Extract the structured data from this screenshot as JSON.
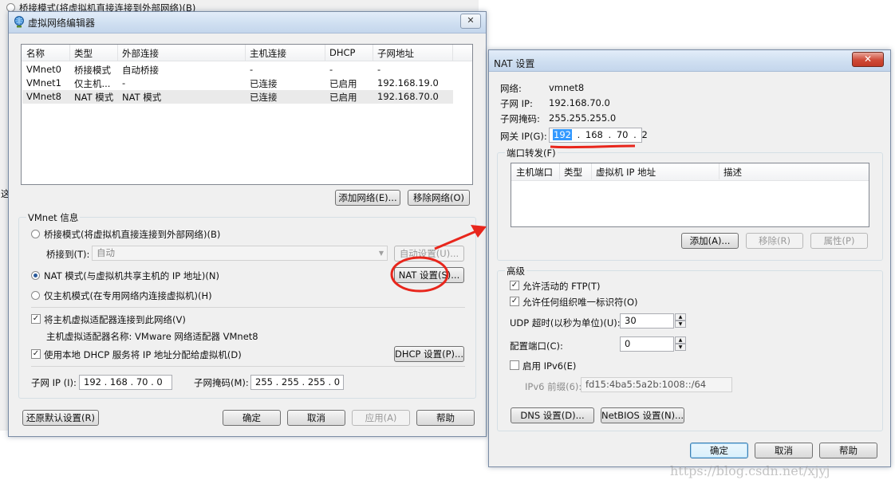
{
  "background_window": {
    "radio_label": "桥接模式(将虚拟机直接连接到外部网络)(B)",
    "left_fragment": "这"
  },
  "vne": {
    "title": "虚拟网络编辑器",
    "close_label": "✕",
    "table": {
      "headers": [
        "名称",
        "类型",
        "外部连接",
        "主机连接",
        "DHCP",
        "子网地址"
      ],
      "rows": [
        [
          "VMnet0",
          "桥接模式",
          "自动桥接",
          "-",
          "-",
          "-"
        ],
        [
          "VMnet1",
          "仅主机...",
          "-",
          "已连接",
          "已启用",
          "192.168.19.0"
        ],
        [
          "VMnet8",
          "NAT 模式",
          "NAT 模式",
          "已连接",
          "已启用",
          "192.168.70.0"
        ]
      ]
    },
    "add_network": "添加网络(E)...",
    "remove_network": "移除网络(O)",
    "vmnet_info": "VMnet 信息",
    "bridge_mode": "桥接模式(将虚拟机直接连接到外部网络)(B)",
    "bridge_to_label": "桥接到(T):",
    "bridge_to_value": "自动",
    "auto_settings": "自动设置(U)...",
    "nat_mode": "NAT 模式(与虚拟机共享主机的 IP 地址)(N)",
    "nat_settings": "NAT 设置(S)...",
    "host_only": "仅主机模式(在专用网络内连接虚拟机)(H)",
    "connect_adapter": "将主机虚拟适配器连接到此网络(V)",
    "adapter_name": "主机虚拟适配器名称: VMware 网络适配器 VMnet8",
    "use_dhcp": "使用本地 DHCP 服务将 IP 地址分配给虚拟机(D)",
    "dhcp_settings": "DHCP 设置(P)...",
    "subnet_ip_label": "子网 IP (I):",
    "subnet_ip": "192 . 168 . 70 . 0",
    "subnet_mask_label": "子网掩码(M):",
    "subnet_mask": "255 . 255 . 255 . 0",
    "restore_defaults": "还原默认设置(R)",
    "ok": "确定",
    "cancel": "取消",
    "apply": "应用(A)",
    "help": "帮助"
  },
  "nat": {
    "title": "NAT 设置",
    "close_label": "✕",
    "network_label": "网络:",
    "network_value": "vmnet8",
    "subnet_ip_label": "子网 IP:",
    "subnet_ip_value": "192.168.70.0",
    "subnet_mask_label": "子网掩码:",
    "subnet_mask_value": "255.255.255.0",
    "gateway_label": "网关 IP(G):",
    "gateway_octets": [
      "192",
      "168",
      "70",
      "2"
    ],
    "port_forwarding": "端口转发(F)",
    "pf_headers": [
      "主机端口",
      "类型",
      "虚拟机 IP 地址",
      "描述"
    ],
    "add": "添加(A)...",
    "remove": "移除(R)",
    "properties": "属性(P)",
    "advanced": "高级",
    "allow_ftp": "允许活动的 FTP(T)",
    "allow_uid": "允许任何组织唯一标识符(O)",
    "udp_timeout_label": "UDP 超时(以秒为单位)(U):",
    "udp_timeout": "30",
    "config_port_label": "配置端口(C):",
    "config_port": "0",
    "enable_ipv6": "启用 IPv6(E)",
    "ipv6_prefix_label": "IPv6 前缀(6):",
    "ipv6_prefix": "fd15:4ba5:5a2b:1008::/64",
    "dns_settings": "DNS 设置(D)...",
    "netbios_settings": "NetBIOS 设置(N)...",
    "ok": "确定",
    "cancel": "取消",
    "help": "帮助"
  },
  "watermark": "https://blog.csdn.net/xjyj",
  "colors": {
    "annotation_red": "#e8261c",
    "selection_blue": "#3399ff"
  }
}
